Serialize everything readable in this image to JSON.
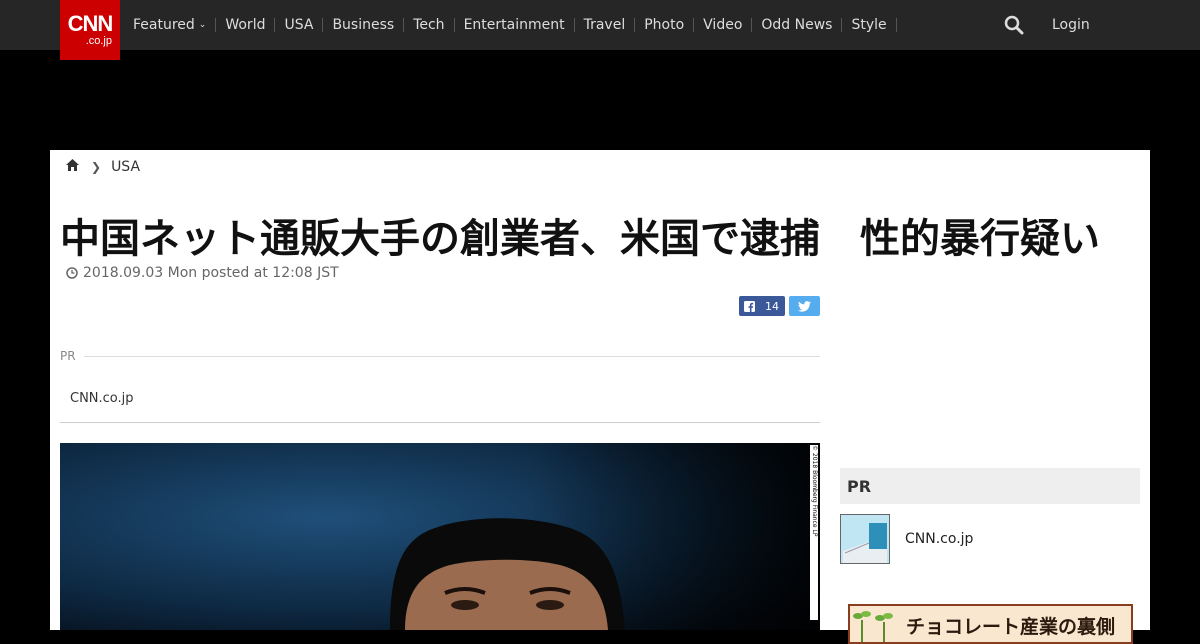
{
  "logo": {
    "text": "CNN",
    "sub": ".co.jp"
  },
  "nav": {
    "items": [
      "Featured",
      "World",
      "USA",
      "Business",
      "Tech",
      "Entertainment",
      "Travel",
      "Photo",
      "Video",
      "Odd News",
      "Style"
    ],
    "login": "Login"
  },
  "breadcrumb": {
    "section": "USA"
  },
  "article": {
    "title": "中国ネット通販大手の創業者、米国で逮捕　性的暴行疑い",
    "date": "2018.09.03 Mon posted at 12:08 JST",
    "fb_count": "14"
  },
  "pr": {
    "label": "PR",
    "link": "CNN.co.jp"
  },
  "photo": {
    "credit": "© 2018 Bloomberg Finance LP"
  },
  "sidebar": {
    "pr_heading": "PR",
    "pr_link": "CNN.co.jp",
    "banner_text": "チョコレート産業の裏側"
  }
}
